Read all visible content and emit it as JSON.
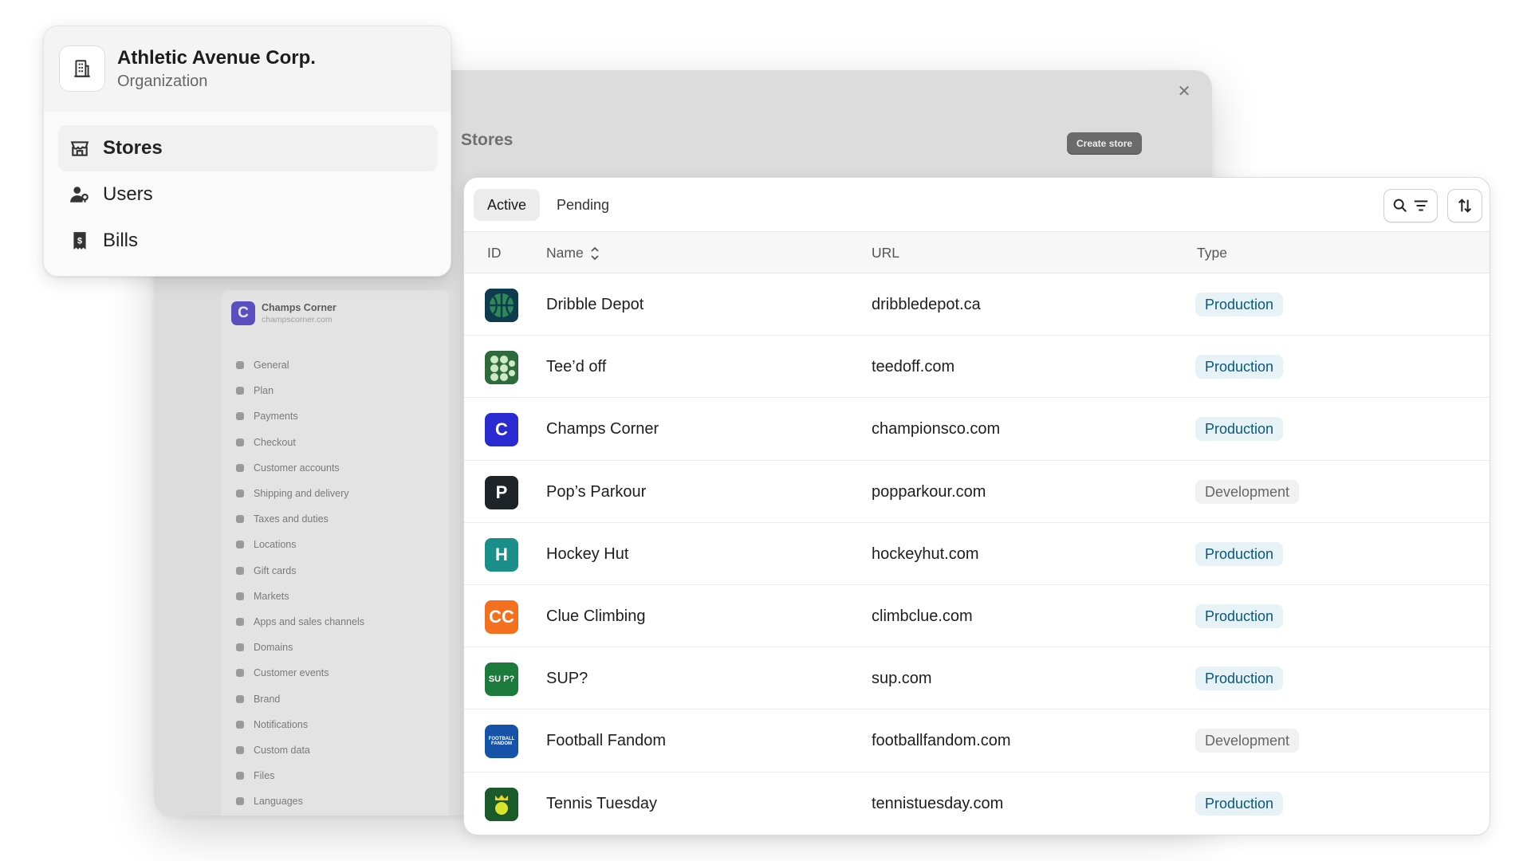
{
  "colors": {
    "accent": "#08587a",
    "production_bg": "#e7f2f7",
    "development_bg": "#f1f1f1"
  },
  "org": {
    "name": "Athletic Avenue Corp.",
    "type": "Organization",
    "icon": "building-icon",
    "nav": [
      {
        "label": "Stores",
        "icon": "store-icon",
        "active": true
      },
      {
        "label": "Users",
        "icon": "users-icon",
        "active": false
      },
      {
        "label": "Bills",
        "icon": "receipt-icon",
        "active": false
      }
    ]
  },
  "background": {
    "title": "Stores",
    "create_label": "Create store",
    "store": {
      "initial": "C",
      "name": "Champs Corner",
      "url": "champscorner.com"
    },
    "settings": [
      "General",
      "Plan",
      "Payments",
      "Checkout",
      "Customer accounts",
      "Shipping and delivery",
      "Taxes and duties",
      "Locations",
      "Gift cards",
      "Markets",
      "Apps and sales channels",
      "Domains",
      "Customer events",
      "Brand",
      "Notifications",
      "Custom data",
      "Files",
      "Languages"
    ]
  },
  "table": {
    "tabs": [
      {
        "label": "Active",
        "active": true
      },
      {
        "label": "Pending",
        "active": false
      }
    ],
    "columns": {
      "id": "ID",
      "name": "Name",
      "url": "URL",
      "type": "Type"
    },
    "rows": [
      {
        "name": "Dribble Depot",
        "url": "dribbledepot.ca",
        "type": "Production",
        "logo_color": "#0f3b4f",
        "logo_mark": ""
      },
      {
        "name": "Tee’d off",
        "url": "teedoff.com",
        "type": "Production",
        "logo_color": "#2e6b3c",
        "logo_mark": ""
      },
      {
        "name": "Champs Corner",
        "url": "championsco.com",
        "type": "Production",
        "logo_color": "#2a2ad1",
        "logo_mark": "C"
      },
      {
        "name": "Pop’s Parkour",
        "url": "popparkour.com",
        "type": "Development",
        "logo_color": "#1f2428",
        "logo_mark": "P"
      },
      {
        "name": "Hockey Hut",
        "url": "hockeyhut.com",
        "type": "Production",
        "logo_color": "#1a8f8a",
        "logo_mark": "H"
      },
      {
        "name": "Clue Climbing",
        "url": "climbclue.com",
        "type": "Production",
        "logo_color": "#f2701e",
        "logo_mark": "CC"
      },
      {
        "name": "SUP?",
        "url": "sup.com",
        "type": "Production",
        "logo_color": "#1c7a3a",
        "logo_mark": "SU P?"
      },
      {
        "name": "Football Fandom",
        "url": "footballfandom.com",
        "type": "Development",
        "logo_color": "#1553a8",
        "logo_mark": "FOOTBALL FANDOM"
      },
      {
        "name": "Tennis Tuesday",
        "url": "tennistuesday.com",
        "type": "Production",
        "logo_color": "#1b5a2a",
        "logo_mark": ""
      }
    ]
  }
}
